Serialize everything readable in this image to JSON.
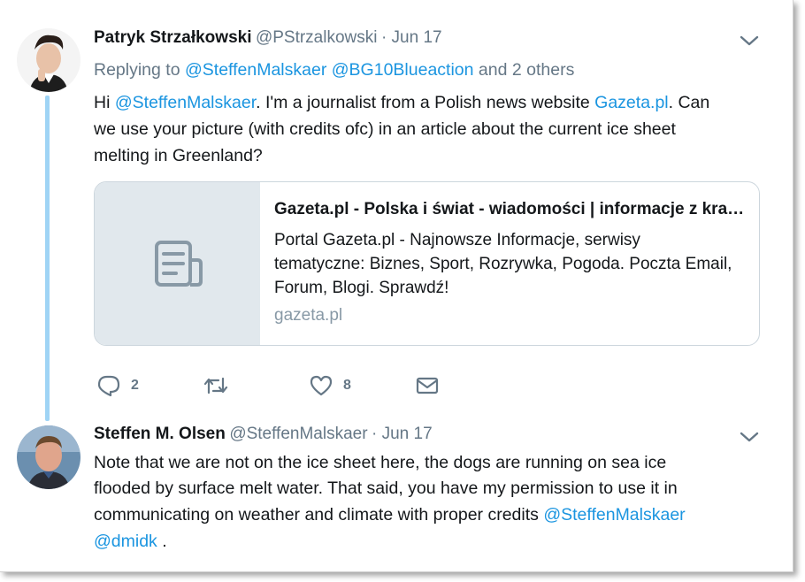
{
  "tweet1": {
    "name": "Patryk Strzałkowski",
    "handle": "@PStrzalkowski",
    "date": "· Jun 17",
    "reply_prefix": "Replying to",
    "reply_mention1": "@SteffenMalskaer",
    "reply_mention2": "@BG10Blueaction",
    "reply_others": "and 2 others",
    "line1_pre": "Hi ",
    "line1_mention": "@SteffenMalskaer",
    "line1_mid": ". I'm a journalist from a Polish news website ",
    "line1_link": "Gazeta.pl",
    "line1_post": ". Can",
    "line2": "we use your picture (with credits ofc) in an article about the current ice sheet",
    "line3": "melting in Greenland?",
    "card": {
      "title": "Gazeta.pl - Polska i świat - wiadomości | informacje z kraju i ze świata",
      "description": "Portal Gazeta.pl - Najnowsze Informacje, serwisy tematyczne: Biznes, Sport, Rozrywka, Pogoda. Poczta Email, Forum, Blogi. Sprawdź!",
      "domain": "gazeta.pl",
      "media_icon": "document-icon"
    },
    "actions": {
      "reply_count": "2",
      "retweet_count": "",
      "like_count": "8"
    }
  },
  "tweet2": {
    "name": "Steffen M. Olsen",
    "handle": "@SteffenMalskaer",
    "date": "· Jun 17",
    "line1": "Note that we are not on the ice sheet here, the dogs are running on sea ice",
    "line2": "flooded by surface melt water. That said, you have my permission to use it in",
    "line3_pre": "communicating on weather and climate with proper credits ",
    "line3_mention": "@SteffenMalskaer",
    "line4_mention": "@dmidk",
    "line4_post": " ."
  },
  "colors": {
    "link": "#1b95e0",
    "secondary": "#657786",
    "thread_line": "#9fd4f5",
    "card_media_bg": "#e1e8ed"
  }
}
